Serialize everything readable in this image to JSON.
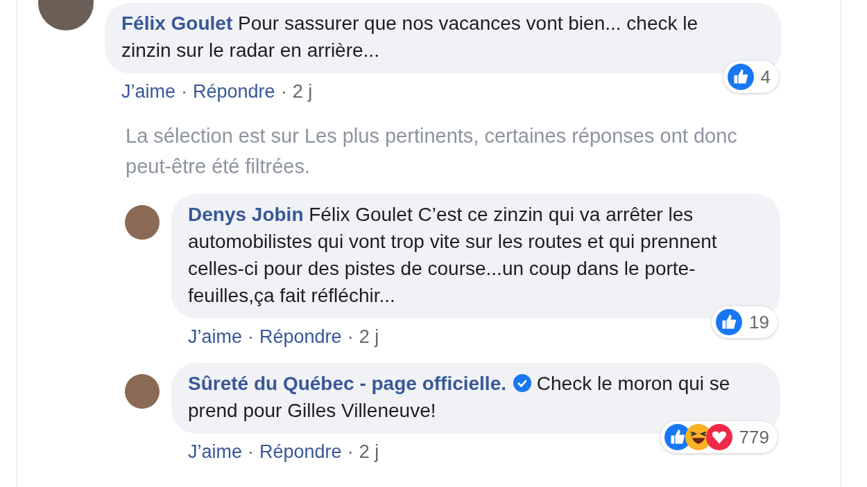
{
  "comments": [
    {
      "author": "Félix Goulet",
      "verified": false,
      "text": "Pour sassurer que nos vacances vont bien... check le zinzin sur le radar en arrière...",
      "reactions": [
        {
          "kind": "like"
        }
      ],
      "reaction_count": "4",
      "like_link": "J’aime",
      "reply_link": "Répondre",
      "separator": "·",
      "time": "2 j",
      "filter_notice": "La sélection est sur Les plus pertinents, certaines réponses ont donc peut-être été filtrées.",
      "replies": [
        {
          "author": "Denys Jobin",
          "verified": false,
          "text": "Félix Goulet C’est ce zinzin qui va arrêter les automobilistes qui vont trop vite sur les routes et qui prennent celles-ci pour des pistes de course...un coup dans le porte-feuilles,ça fait réfléchir...",
          "reactions": [
            {
              "kind": "like"
            }
          ],
          "reaction_count": "19",
          "like_link": "J’aime",
          "reply_link": "Répondre",
          "separator": "·",
          "time": "2 j"
        },
        {
          "author": "Sûreté du Québec - page officielle.",
          "verified": true,
          "text": "Check le moron qui se prend pour Gilles Villeneuve!",
          "reactions": [
            {
              "kind": "like"
            },
            {
              "kind": "haha"
            },
            {
              "kind": "love"
            }
          ],
          "reaction_count": "779",
          "like_link": "J’aime",
          "reply_link": "Répondre",
          "separator": "·",
          "time": "2 j"
        }
      ]
    }
  ]
}
